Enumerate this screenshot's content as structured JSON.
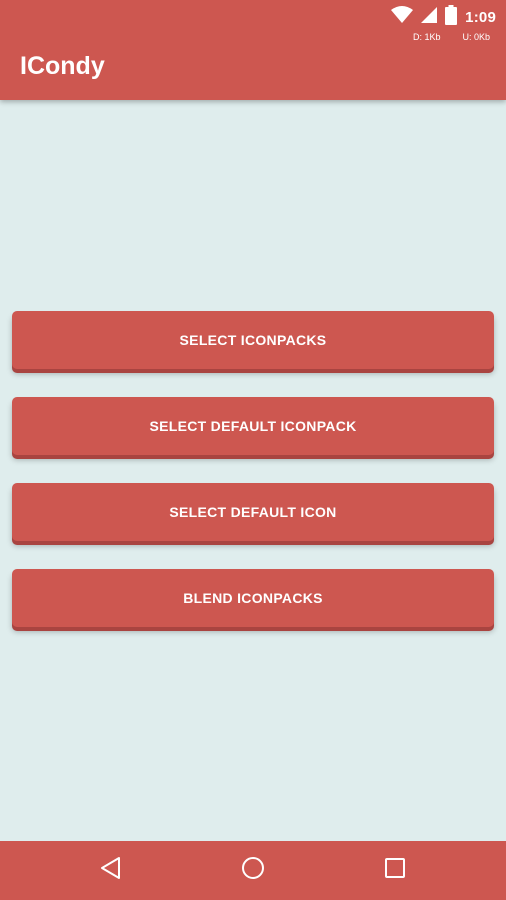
{
  "status_bar": {
    "time": "1:09",
    "download": "D: 1Kb",
    "upload": "U: 0Kb",
    "icons": [
      "wifi-icon",
      "cell-signal-icon",
      "battery-icon"
    ]
  },
  "app_bar": {
    "title": "ICondy"
  },
  "actions": [
    {
      "label": "SELECT ICONPACKS"
    },
    {
      "label": "SELECT DEFAULT ICONPACK"
    },
    {
      "label": "SELECT DEFAULT ICON"
    },
    {
      "label": "BLEND ICONPACKS"
    }
  ],
  "nav_bar": {
    "icons": [
      "back-icon",
      "home-icon",
      "recents-icon"
    ]
  },
  "colors": {
    "primary": "#cd5750",
    "background": "#dfeded",
    "button_shadow": "#a94440",
    "on_primary": "#ffffff"
  }
}
